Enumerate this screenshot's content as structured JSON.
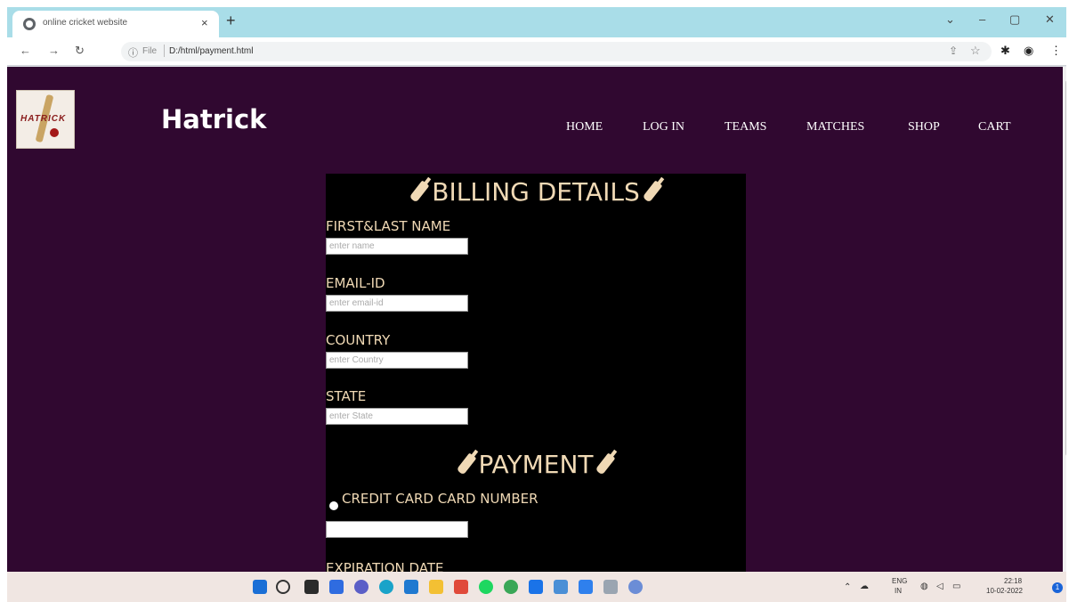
{
  "browser": {
    "tab_title": "online cricket website",
    "tab_close": "×",
    "new_tab": "+",
    "url_scheme": "File",
    "url": "D:/html/payment.html",
    "controls": {
      "minimize": "–",
      "maximize": "▢",
      "close": "✕",
      "dropdown": "⌄"
    }
  },
  "site": {
    "brand": "Hatrick",
    "logo_text": "HATRICK",
    "nav": [
      "HOME",
      "LOG IN",
      "TEAMS",
      "MATCHES",
      "SHOP",
      "CART"
    ]
  },
  "billing": {
    "heading": "BILLING DETAILS",
    "fields": [
      {
        "label": "FIRST&LAST NAME",
        "placeholder": "enter name"
      },
      {
        "label": "EMAIL-ID",
        "placeholder": "enter email-id"
      },
      {
        "label": "COUNTRY",
        "placeholder": "enter Country"
      },
      {
        "label": "STATE",
        "placeholder": "enter State"
      }
    ]
  },
  "payment": {
    "heading": "PAYMENT",
    "credit_card_label": "CREDIT CARD CARD NUMBER",
    "card_number_value": "",
    "expiration_label": "EXPIRATION DATE"
  },
  "taskbar": {
    "lang_top": "ENG",
    "lang_bottom": "IN",
    "time": "22:18",
    "date": "10-02-2022",
    "notifications": "1"
  }
}
